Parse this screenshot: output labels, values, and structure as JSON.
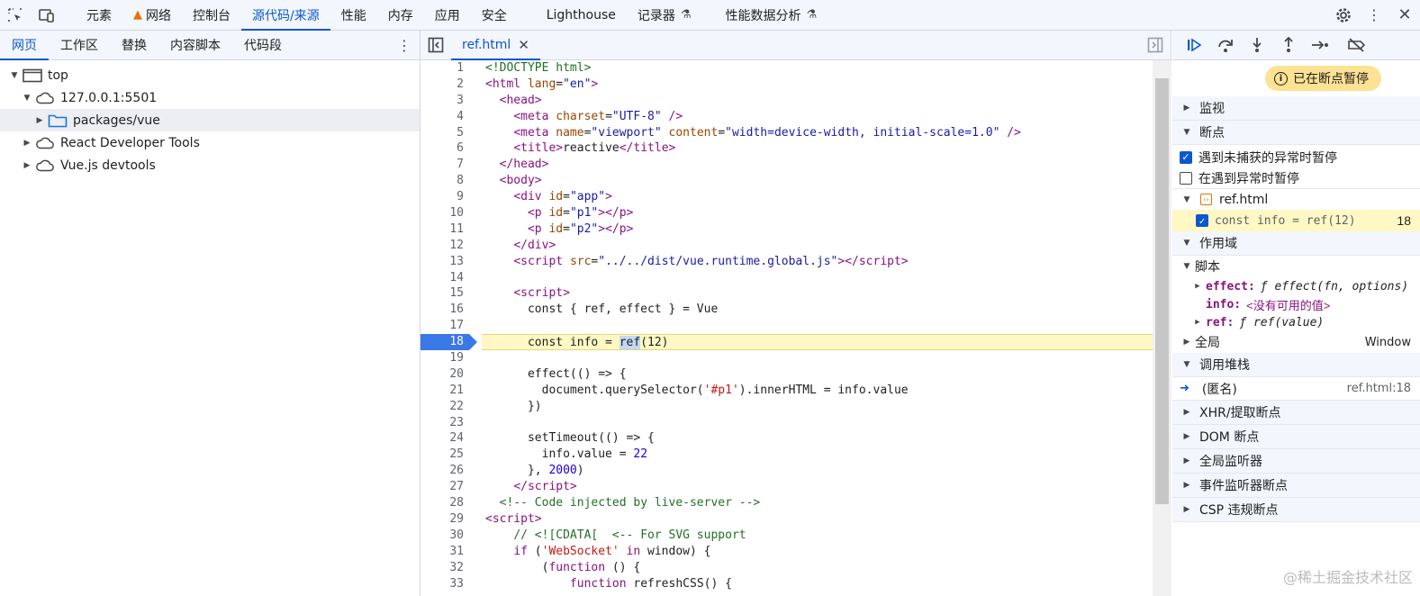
{
  "topbar": {
    "tabs": [
      "元素",
      "网络",
      "控制台",
      "源代码/来源",
      "性能",
      "内存",
      "应用",
      "安全",
      "Lighthouse",
      "记录器",
      "性能数据分析"
    ],
    "active_tab": "源代码/来源"
  },
  "navigator": {
    "tabs": [
      "网页",
      "工作区",
      "替换",
      "内容脚本",
      "代码段"
    ],
    "tree": {
      "top": "top",
      "host": "127.0.0.1:5501",
      "folder": "packages/vue",
      "ext1": "React Developer Tools",
      "ext2": "Vue.js devtools"
    }
  },
  "editor": {
    "file_tab": "ref.html",
    "current_line": 18
  },
  "debugger": {
    "paused_label": "已在断点暂停",
    "sections": {
      "watch": "监视",
      "breakpoints": "断点",
      "scope": "作用域",
      "callstack": "调用堆栈",
      "xhr": "XHR/提取断点",
      "dom": "DOM 断点",
      "global_listeners": "全局监听器",
      "event_breakpoints": "事件监听器断点",
      "csp": "CSP 违规断点"
    },
    "pause_uncaught": "遇到未捕获的异常时暂停",
    "pause_caught": "在遇到异常时暂停",
    "bp_file": "ref.html",
    "bp_code": "const info = ref(12)",
    "bp_line": "18",
    "scope_script": "脚本",
    "scope_effect_key": "effect:",
    "scope_effect_val": "ƒ effect(fn, options)",
    "scope_info_key": "info:",
    "scope_info_val": "<没有可用的值>",
    "scope_ref_key": "ref:",
    "scope_ref_val": "ƒ ref(value)",
    "scope_global": "全局",
    "scope_global_val": "Window",
    "stack_fn": "(匿名)",
    "stack_loc": "ref.html:18"
  },
  "watermark": "@稀土掘金技术社区"
}
